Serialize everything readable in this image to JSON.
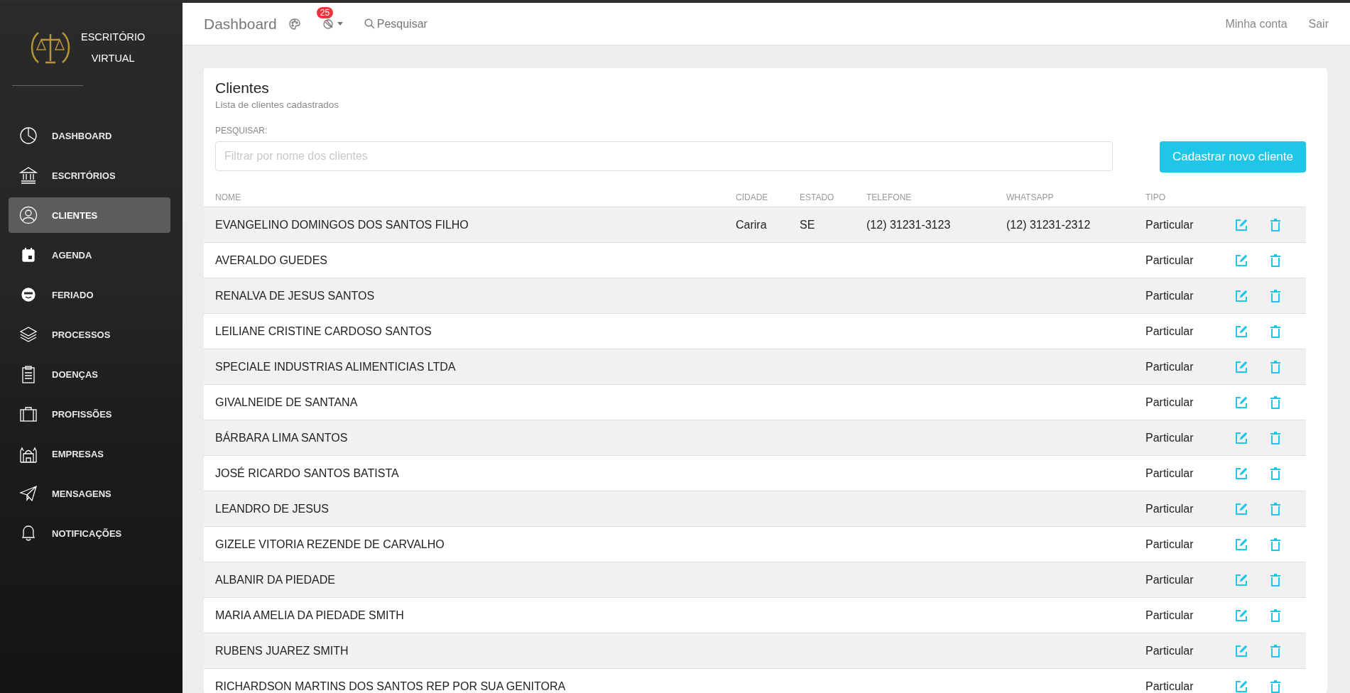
{
  "brand": {
    "line1": "ESCRITÓRIO",
    "line2": "VIRTUAL"
  },
  "sidebar": {
    "items": [
      {
        "label": "DASHBOARD",
        "selected": false
      },
      {
        "label": "ESCRITÓRIOS",
        "selected": false
      },
      {
        "label": "CLIENTES",
        "selected": true
      },
      {
        "label": "AGENDA",
        "selected": false
      },
      {
        "label": "FERIADO",
        "selected": false
      },
      {
        "label": "PROCESSOS",
        "selected": false
      },
      {
        "label": "DOENÇAS",
        "selected": false
      },
      {
        "label": "PROFISSÕES",
        "selected": false
      },
      {
        "label": "EMPRESAS",
        "selected": false
      },
      {
        "label": "MENSAGENS",
        "selected": false
      },
      {
        "label": "NOTIFICAÇÕES",
        "selected": false
      }
    ]
  },
  "topbar": {
    "title": "Dashboard",
    "badge": "25",
    "search": "Pesquisar",
    "links": [
      "Minha conta",
      "Sair"
    ]
  },
  "card": {
    "title": "Clientes",
    "subtitle": "Lista de clientes cadastrados",
    "search_label": "PESQUISAR:",
    "search_placeholder": "Filtrar por nome dos clientes",
    "button": "Cadastrar novo cliente"
  },
  "table": {
    "columns": [
      "NOME",
      "CIDADE",
      "ESTADO",
      "TELEFONE",
      "WHATSAPP",
      "TIPO"
    ],
    "rows": [
      {
        "nome": "EVANGELINO DOMINGOS DOS SANTOS FILHO",
        "cidade": "Carira",
        "estado": "SE",
        "telefone": "(12) 31231-3123",
        "whatsapp": "(12) 31231-2312",
        "tipo": "Particular"
      },
      {
        "nome": "AVERALDO GUEDES",
        "tipo": "Particular"
      },
      {
        "nome": "RENALVA DE JESUS SANTOS",
        "tipo": "Particular"
      },
      {
        "nome": "LEILIANE CRISTINE CARDOSO SANTOS",
        "tipo": "Particular"
      },
      {
        "nome": "SPECIALE INDUSTRIAS ALIMENTICIAS LTDA",
        "tipo": "Particular"
      },
      {
        "nome": "GIVALNEIDE DE SANTANA",
        "tipo": "Particular"
      },
      {
        "nome": "BÁRBARA LIMA SANTOS",
        "tipo": "Particular"
      },
      {
        "nome": "JOSÉ RICARDO SANTOS BATISTA",
        "tipo": "Particular"
      },
      {
        "nome": "LEANDRO DE JESUS",
        "tipo": "Particular"
      },
      {
        "nome": "GIZELE VITORIA REZENDE DE CARVALHO",
        "tipo": "Particular"
      },
      {
        "nome": "ALBANIR DA PIEDADE",
        "tipo": "Particular"
      },
      {
        "nome": "MARIA AMELIA DA PIEDADE SMITH",
        "tipo": "Particular"
      },
      {
        "nome": "RUBENS JUAREZ SMITH",
        "tipo": "Particular"
      },
      {
        "nome": "RICHARDSON MARTINS DOS SANTOS REP POR SUA GENITORA",
        "tipo": "Particular"
      }
    ]
  }
}
